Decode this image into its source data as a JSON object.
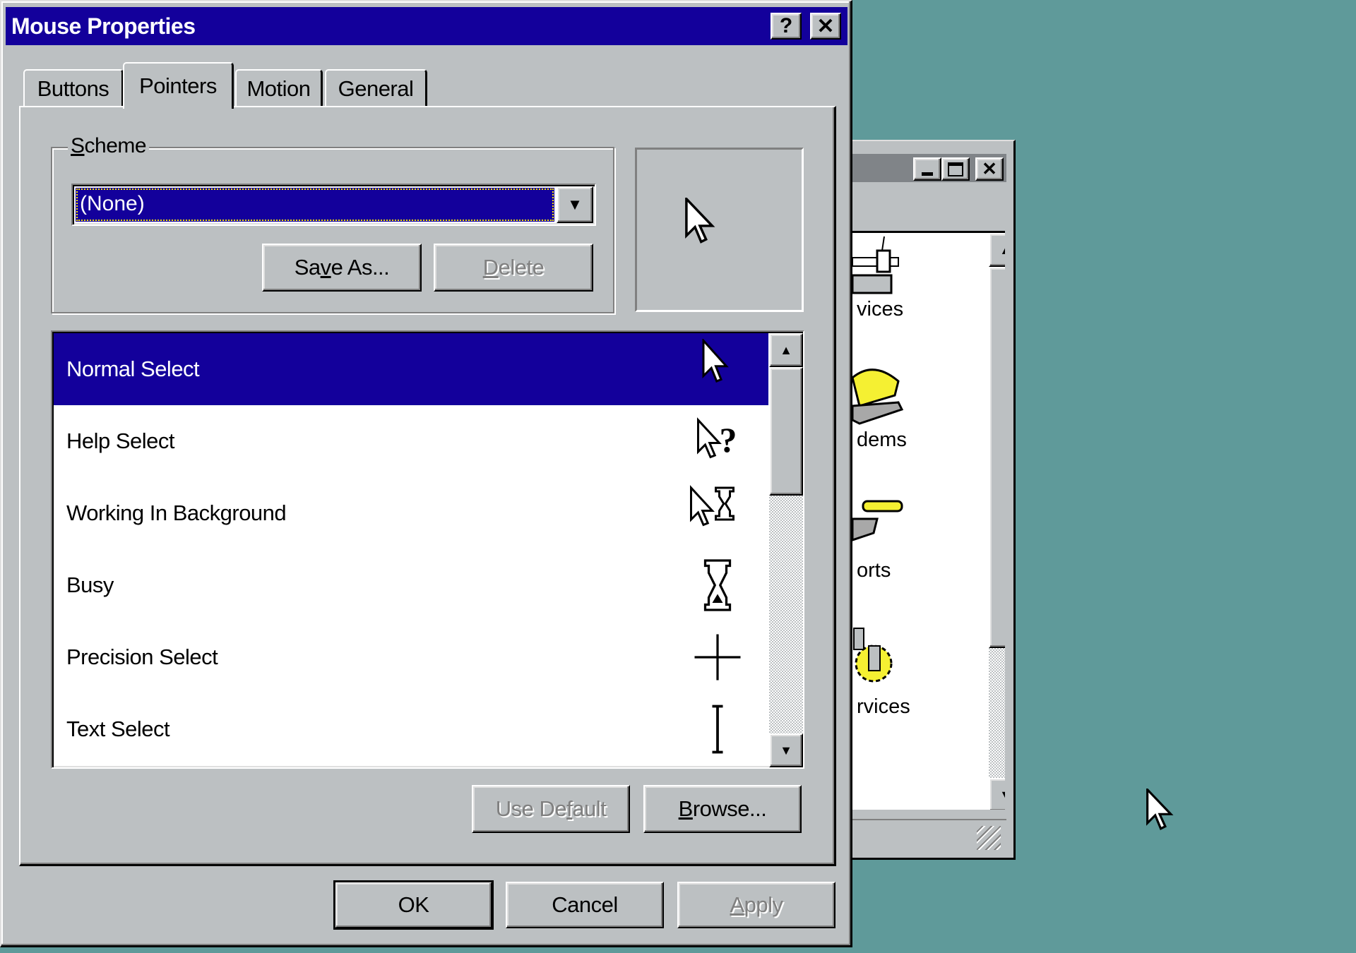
{
  "desktop": {
    "background_color": "#5f9a9a"
  },
  "background_window": {
    "title": "",
    "buttons": {
      "minimize_icon": "minimize-icon",
      "maximize_icon": "maximize-icon",
      "close_icon": "close-icon"
    },
    "items": [
      {
        "label": "vices",
        "icon": "devices-icon"
      },
      {
        "label": "dems",
        "icon": "modems-icon"
      },
      {
        "label": "orts",
        "icon": "ports-icon"
      },
      {
        "label": "rvices",
        "icon": "services-icon"
      }
    ],
    "scroll": {
      "thumb_fraction": 0.74,
      "position": 0
    }
  },
  "dialog": {
    "title": "Mouse Properties",
    "help_label": "?",
    "close_label": "✕",
    "tabs": [
      {
        "label": "Buttons",
        "active": false
      },
      {
        "label": "Pointers",
        "active": true
      },
      {
        "label": "Motion",
        "active": false
      },
      {
        "label": "General",
        "active": false
      }
    ],
    "scheme": {
      "legend_accel": "S",
      "legend_rest": "cheme",
      "selected_value": "(None)",
      "save_as": {
        "pre": "Sa",
        "accel": "v",
        "post": "e As..."
      },
      "delete": {
        "pre": "",
        "accel": "D",
        "post": "elete",
        "disabled": true
      }
    },
    "preview": {
      "cursor": "normal-select-cursor"
    },
    "pointers": [
      {
        "label": "Normal Select",
        "icon": "arrow-cursor",
        "selected": true
      },
      {
        "label": "Help Select",
        "icon": "help-cursor",
        "selected": false
      },
      {
        "label": "Working In Background",
        "icon": "working-cursor",
        "selected": false
      },
      {
        "label": "Busy",
        "icon": "hourglass-cursor",
        "selected": false
      },
      {
        "label": "Precision Select",
        "icon": "crosshair-cursor",
        "selected": false
      },
      {
        "label": "Text Select",
        "icon": "ibeam-cursor",
        "selected": false
      }
    ],
    "list_scroll": {
      "thumb_fraction": 0.35,
      "position": 0
    },
    "use_default": {
      "pre": "Use De",
      "accel": "f",
      "post": "ault",
      "disabled": true
    },
    "browse": {
      "pre": "",
      "accel": "B",
      "post": "rowse...",
      "disabled": false
    },
    "footer": {
      "ok": "OK",
      "cancel": "Cancel",
      "apply": {
        "pre": "",
        "accel": "A",
        "post": "pply",
        "disabled": true
      }
    }
  }
}
